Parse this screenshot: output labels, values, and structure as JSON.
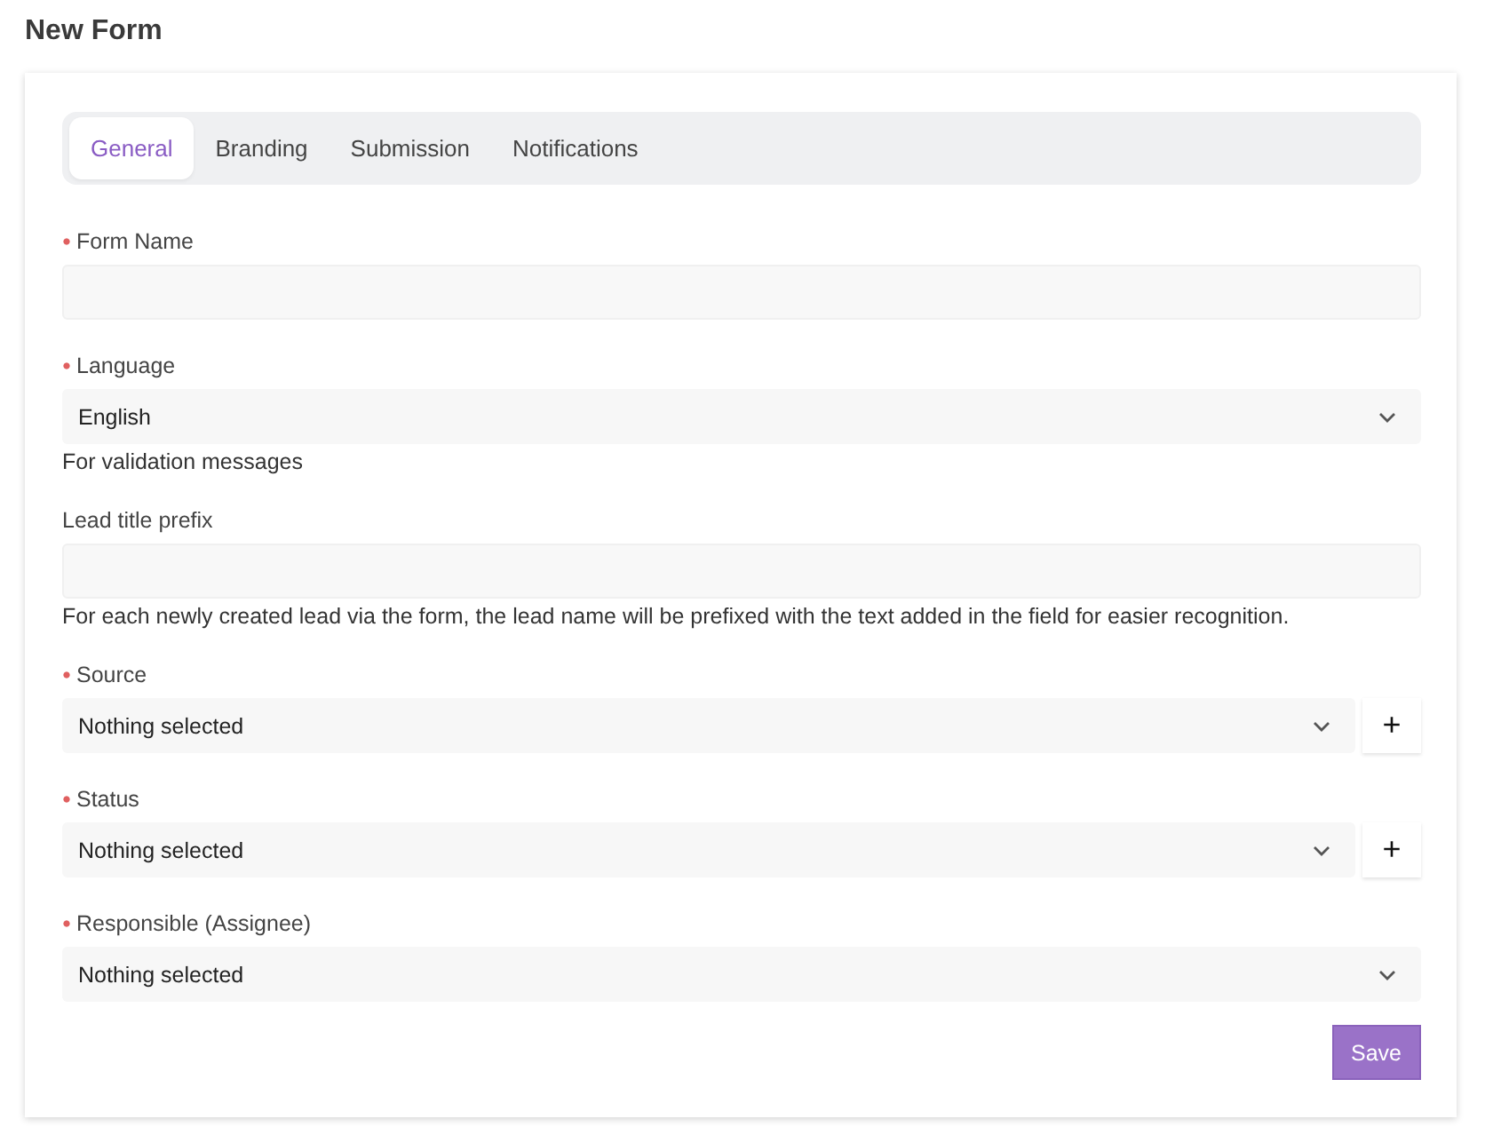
{
  "page_title": "New Form",
  "tabs": [
    {
      "label": "General",
      "selected": true
    },
    {
      "label": "Branding",
      "selected": false
    },
    {
      "label": "Submission",
      "selected": false
    },
    {
      "label": "Notifications",
      "selected": false
    }
  ],
  "fields": [
    {
      "kind": "text",
      "label": "Form Name",
      "required": true
    },
    {
      "kind": "select",
      "label": "Language",
      "required": true,
      "value": "English",
      "help": "For validation messages"
    },
    {
      "kind": "text",
      "label": "Lead title prefix",
      "required": false,
      "help": "For each newly created lead via the form, the lead name will be prefixed with the text added in the field for easier recognition."
    },
    {
      "kind": "select",
      "label": "Source",
      "required": true,
      "value": "Nothing selected",
      "add_button": "+"
    },
    {
      "kind": "select",
      "label": "Status",
      "required": true,
      "value": "Nothing selected",
      "add_button": "+"
    },
    {
      "kind": "select",
      "label": "Responsible (Assignee)",
      "required": true,
      "value": "Nothing selected"
    }
  ],
  "save_button": "Save"
}
